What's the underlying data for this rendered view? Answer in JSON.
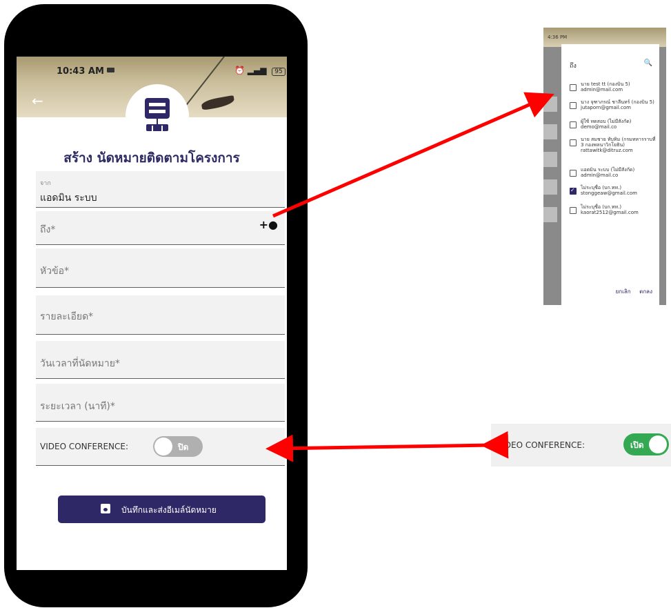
{
  "status": {
    "time": "10:43 AM",
    "battery": "95"
  },
  "form": {
    "title": "สร้าง นัดหมายติดตามโครงการ",
    "from": {
      "label": "จาก",
      "value": "แอดมิน ระบบ"
    },
    "to": {
      "label": "ถึง*"
    },
    "subject": {
      "label": "หัวข้อ*"
    },
    "details": {
      "label": "รายละเอียด*"
    },
    "datetime": {
      "label": "วันเวลาที่นัดหมาย*"
    },
    "duration": {
      "label": "ระยะเวลา (นาที)*"
    },
    "video": {
      "label": "VIDEO CONFERENCE:",
      "state": "ปิด"
    },
    "save_button": "บันทึกและส่งอีเมล์นัดหมาย"
  },
  "dialog": {
    "status_time": "4:36 PM",
    "title": "ถึง",
    "options": [
      {
        "text": "นาย test tt (กองบิน 5) admin@mail.com",
        "checked": false
      },
      {
        "text": "นาง จุฑาภรณ์ ชาลีนทร์ (กองบิน 5) jutaporn@gmail.com",
        "checked": false
      },
      {
        "text": "ผู้ใช้ ทดสอบ (ไม่มีสังกัด) demo@mail.co",
        "checked": false
      },
      {
        "text": "นาย สมชาย ทับทิม (กรมทหารราบที่ 3 กองพลนาวิกโยธิน) rattawitk@ditruz.com",
        "checked": false
      },
      {
        "text": "แอดมิน ระบบ (ไม่มีสังกัด) admin@mail.co",
        "checked": false
      },
      {
        "text": "ไม่ระบุชื่อ (บก.ทท.) stonggeaw@gmail.com",
        "checked": true
      },
      {
        "text": "ไม่ระบุชื่อ (บก.ทท.) kaorat2512@gmail.com",
        "checked": false
      }
    ],
    "cancel": "ยกเลิก",
    "ok": "ตกลง"
  },
  "inset": {
    "label": "VIDEO CONFERENCE:",
    "state": "เปิด"
  },
  "colors": {
    "primary": "#2e2966",
    "toggle_on": "#34a853",
    "arrow": "#ff0000"
  }
}
